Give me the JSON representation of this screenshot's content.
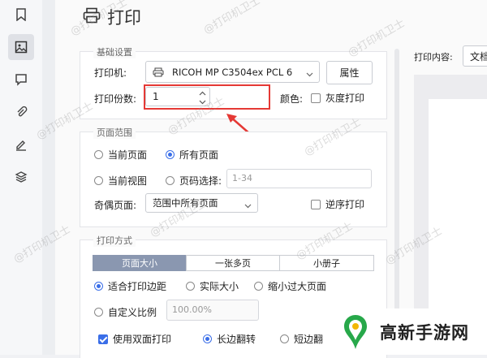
{
  "dialog": {
    "title": "打印"
  },
  "basic": {
    "section_title": "基础设置",
    "printer_label": "打印机:",
    "printer_value": "RICOH MP C3504ex PCL 6",
    "properties_button": "属性",
    "copies_label": "打印份数:",
    "copies_value": "1",
    "color_label": "颜色:",
    "grayscale_label": "灰度打印"
  },
  "range": {
    "section_title": "页面范围",
    "current_page": "当前页面",
    "all_pages": "所有页面",
    "current_view": "当前视图",
    "page_select": "页码选择:",
    "page_select_placeholder": "1-34",
    "odd_even_label": "奇偶页面:",
    "odd_even_value": "范围中所有页面",
    "reverse_label": "逆序打印"
  },
  "mode": {
    "section_title": "打印方式",
    "tabs": [
      "页面大小",
      "一张多页",
      "小册子"
    ],
    "fit_margins": "适合打印边距",
    "actual_size": "实际大小",
    "shrink_large": "缩小过大页面",
    "custom_scale": "自定义比例",
    "custom_scale_value": "100.00%",
    "duplex": "使用双面打印",
    "long_edge": "长边翻转",
    "short_edge": "短边翻"
  },
  "side": {
    "print_content_label": "打印内容:",
    "print_content_value": "文档"
  },
  "watermark": {
    "text": "@打印机卫士"
  },
  "brand": {
    "name": "高新手游网"
  },
  "colors": {
    "accent": "#3a6ee8",
    "highlight": "#e53935",
    "tab_active": "#8a97b0"
  },
  "icons": [
    "bookmark-icon",
    "image-icon",
    "comment-icon",
    "attachment-icon",
    "signature-icon",
    "layers-icon",
    "printer-icon"
  ]
}
